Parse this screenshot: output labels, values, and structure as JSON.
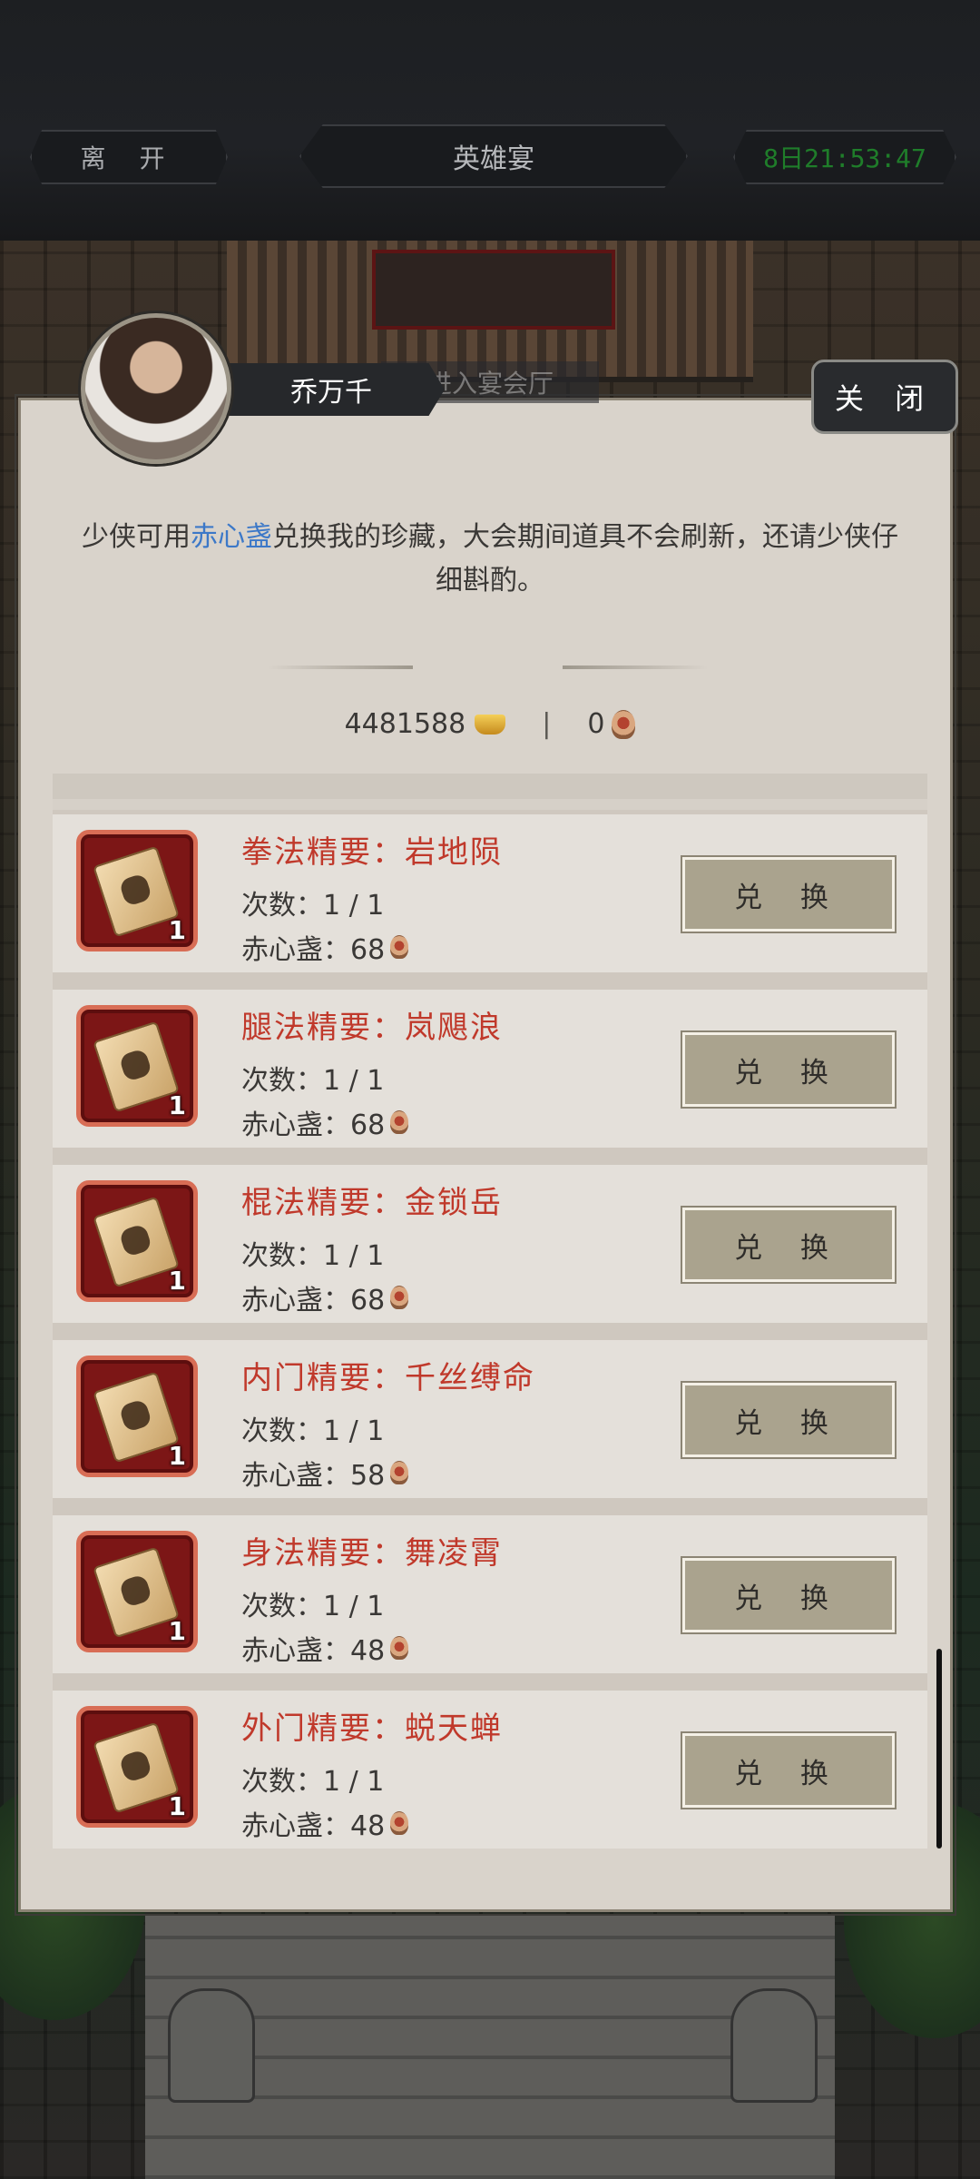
{
  "header": {
    "leave_label": "离 开",
    "title": "英雄宴",
    "timer": "8日21:53:47"
  },
  "dialog": {
    "npc_name": "乔万千",
    "background_tab": "进入宴会厅",
    "close_label": "关 闭",
    "message_before": "少侠可用",
    "message_highlight": "赤心盏",
    "message_after": "兑换我的珍藏，大会期间道具不会刷新，还请少侠仔细斟酌。",
    "gold_amount": "4481588",
    "token_amount": "0",
    "separator": "|"
  },
  "items": [
    {
      "name": "拳法精要：岩地陨",
      "count": "次数：1 / 1",
      "cost": "赤心盏：68",
      "qty": "1",
      "button": "兑 换"
    },
    {
      "name": "腿法精要：岚飓浪",
      "count": "次数：1 / 1",
      "cost": "赤心盏：68",
      "qty": "1",
      "button": "兑 换"
    },
    {
      "name": "棍法精要：金锁岳",
      "count": "次数：1 / 1",
      "cost": "赤心盏：68",
      "qty": "1",
      "button": "兑 换"
    },
    {
      "name": "内门精要：千丝缚命",
      "count": "次数：1 / 1",
      "cost": "赤心盏：58",
      "qty": "1",
      "button": "兑 换"
    },
    {
      "name": "身法精要：舞凌霄",
      "count": "次数：1 / 1",
      "cost": "赤心盏：48",
      "qty": "1",
      "button": "兑 换"
    },
    {
      "name": "外门精要：蜕天蝉",
      "count": "次数：1 / 1",
      "cost": "赤心盏：48",
      "qty": "1",
      "button": "兑 换"
    }
  ],
  "icons": {
    "gold": "gold-ingot-icon",
    "token": "red-heart-cup-icon",
    "item": "manual-book-icon"
  },
  "colors": {
    "item_name": "#c0392b",
    "highlight": "#3c78c8",
    "timer": "#1f7d2a",
    "panel": "#d9d3cb"
  }
}
